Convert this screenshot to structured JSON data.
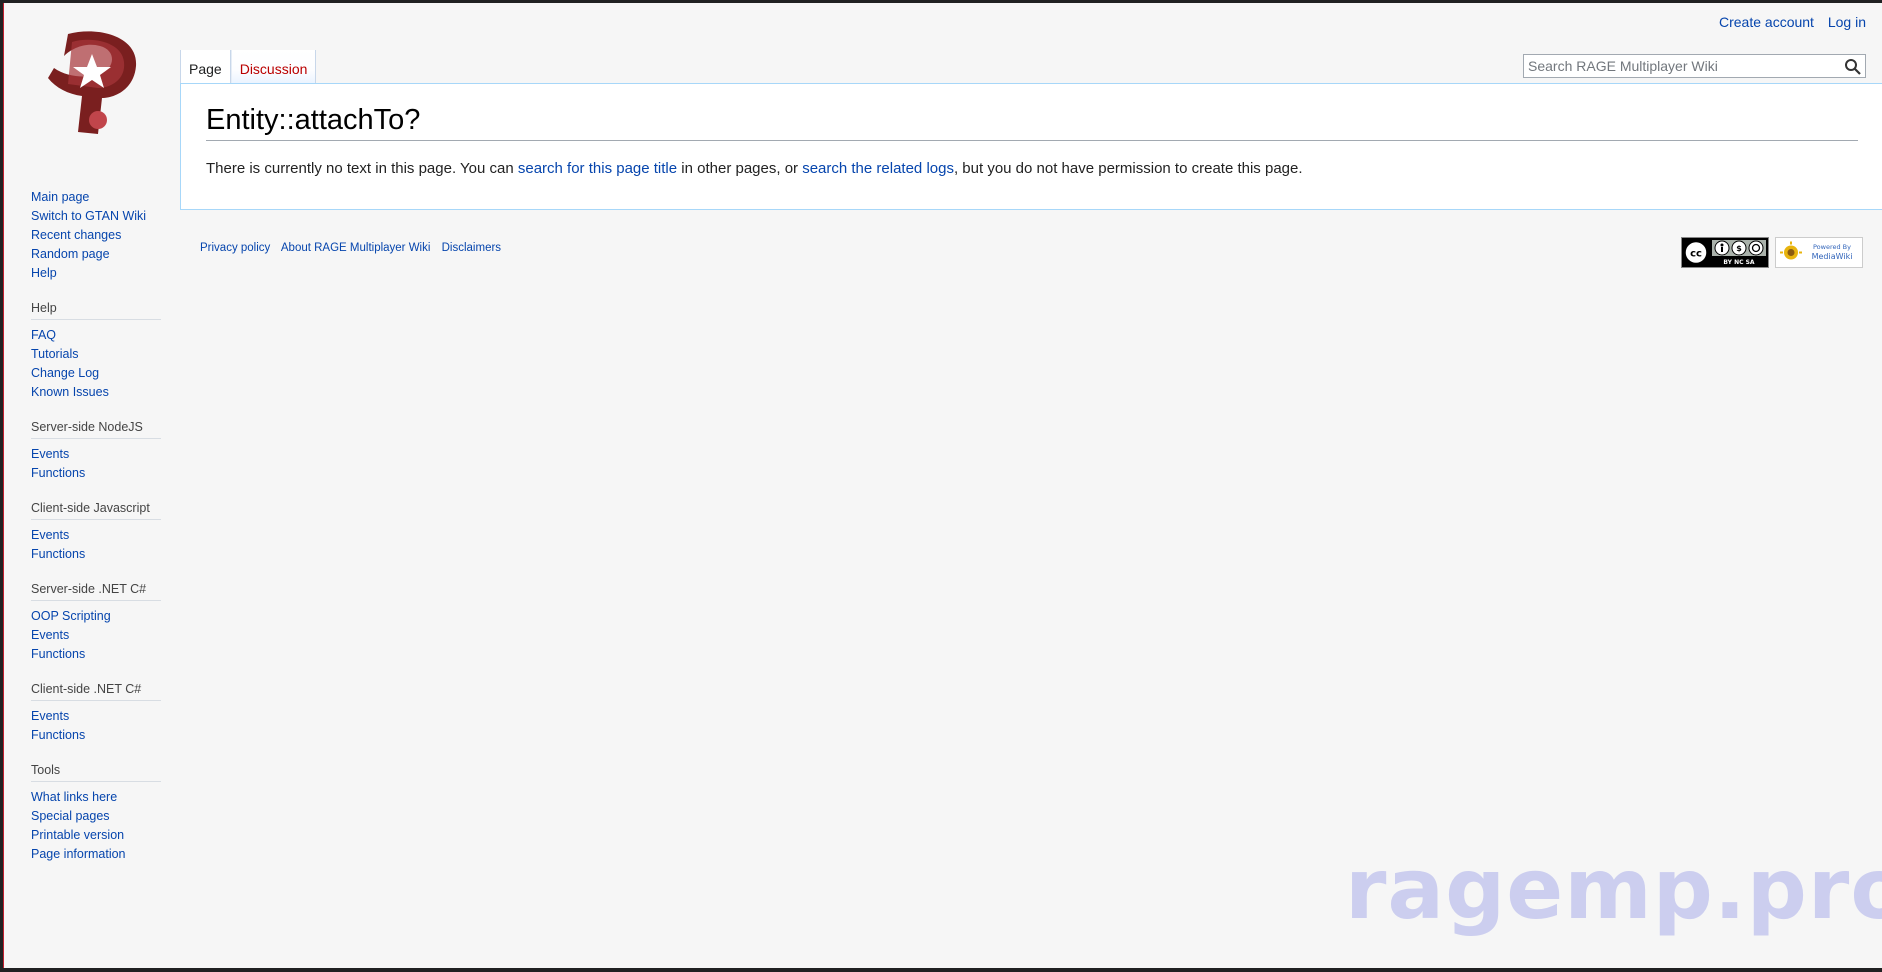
{
  "personal": {
    "create_account": "Create account",
    "log_in": "Log in"
  },
  "tabs": {
    "page": "Page",
    "discussion": "Discussion"
  },
  "search": {
    "placeholder": "Search RAGE Multiplayer Wiki"
  },
  "page": {
    "title": "Entity::attachTo?",
    "text_1": "There is currently no text in this page. You can ",
    "link_1": "search for this page title",
    "text_2": " in other pages, or ",
    "link_2": "search the related logs",
    "text_3": ", but you do not have permission to create this page."
  },
  "sidebar": {
    "nav": [
      "Main page",
      "Switch to GTAN Wiki",
      "Recent changes",
      "Random page",
      "Help"
    ],
    "help": {
      "title": "Help",
      "items": [
        "FAQ",
        "Tutorials",
        "Change Log",
        "Known Issues"
      ]
    },
    "server_node": {
      "title": "Server-side NodeJS",
      "items": [
        "Events",
        "Functions"
      ]
    },
    "client_js": {
      "title": "Client-side Javascript",
      "items": [
        "Events",
        "Functions"
      ]
    },
    "server_net": {
      "title": "Server-side .NET C#",
      "items": [
        "OOP Scripting",
        "Events",
        "Functions"
      ]
    },
    "client_net": {
      "title": "Client-side .NET C#",
      "items": [
        "Events",
        "Functions"
      ]
    },
    "tools": {
      "title": "Tools",
      "items": [
        "What links here",
        "Special pages",
        "Printable version",
        "Page information"
      ]
    }
  },
  "footer": {
    "privacy": "Privacy policy",
    "about": "About RAGE Multiplayer Wiki",
    "disclaimers": "Disclaimers"
  },
  "badges": {
    "cc": "BY NC SA",
    "mw_top": "Powered By",
    "mw_bottom": "MediaWiki"
  },
  "watermark": "ragemp.pro",
  "colors": {
    "link": "#0645ad",
    "new_link": "#ba0000",
    "border": "#a7d7f9",
    "logo_red": "#8b1a1a"
  }
}
